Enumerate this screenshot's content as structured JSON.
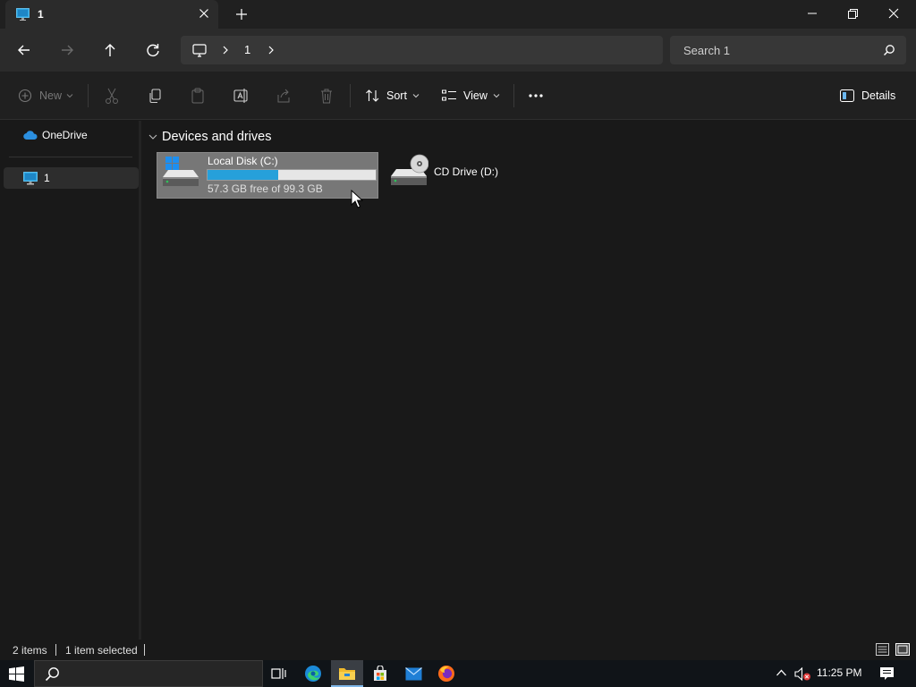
{
  "window": {
    "tab_title": "1",
    "tab_icon": "computer-icon",
    "new_tab_icon": "plus-icon"
  },
  "nav": {
    "breadcrumb": [
      "1"
    ],
    "search_placeholder": "Search 1"
  },
  "toolbar": {
    "new_label": "New",
    "sort_label": "Sort",
    "view_label": "View",
    "details_label": "Details"
  },
  "sidebar": {
    "items": [
      {
        "label": "OneDrive",
        "icon": "cloud-icon"
      },
      {
        "label": "1",
        "icon": "computer-icon",
        "selected": true
      }
    ]
  },
  "content": {
    "group_title": "Devices and drives",
    "drives": [
      {
        "name": "Local Disk (C:)",
        "free_text": "57.3 GB free of 99.3 GB",
        "used_fraction": 0.42,
        "selected": true,
        "icon": "hard-drive-icon"
      },
      {
        "name": "CD Drive (D:)",
        "icon": "cd-drive-icon"
      }
    ]
  },
  "status": {
    "item_count": "2 items",
    "selection": "1 item selected"
  },
  "taskbar": {
    "clock": "11:25 PM",
    "apps": [
      "task-view-icon",
      "edge-icon",
      "file-explorer-icon",
      "store-icon",
      "mail-icon",
      "firefox-icon"
    ]
  },
  "colors": {
    "usage_bar": "#26a0da",
    "selection": "#777777",
    "accent": "#0078d4"
  }
}
